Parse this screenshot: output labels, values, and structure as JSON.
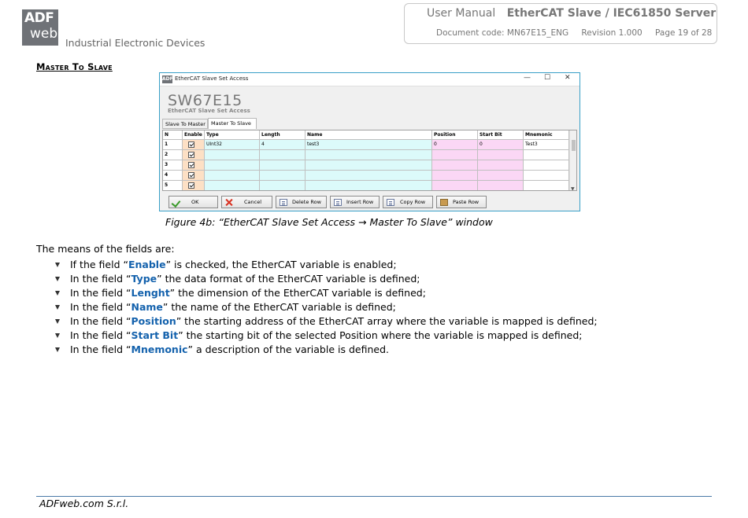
{
  "header": {
    "logo_top": "ADF",
    "logo_bottom": "web",
    "tagline": "Industrial Electronic Devices",
    "manual_label": "User Manual",
    "product": "EtherCAT Slave / IEC61850 Server",
    "document_code": "Document code: MN67E15_ENG",
    "revision": "Revision 1.000",
    "page": "Page 19 of 28"
  },
  "section_title": "Master To Slave",
  "window": {
    "title": "EtherCAT Slave Set Access",
    "app_icon_text": "ADF",
    "controls": {
      "minimize": "—",
      "maximize": "☐",
      "close": "✕"
    },
    "app_name": "SW67E15",
    "app_subtitle": "EtherCAT Slave Set Access",
    "tabs": [
      {
        "label": "Slave To Master",
        "active": false
      },
      {
        "label": "Master To Slave",
        "active": true
      }
    ],
    "table": {
      "columns": [
        "N",
        "Enable",
        "Type",
        "Length",
        "Name",
        "Position",
        "Start Bit",
        "Mnemonic"
      ],
      "rows": [
        {
          "n": "1",
          "enable": true,
          "type": "UInt32",
          "length": "4",
          "name": "test3",
          "position": "0",
          "start_bit": "0",
          "mnemonic": "Test3"
        },
        {
          "n": "2",
          "enable": true,
          "type": "",
          "length": "",
          "name": "",
          "position": "",
          "start_bit": "",
          "mnemonic": ""
        },
        {
          "n": "3",
          "enable": true,
          "type": "",
          "length": "",
          "name": "",
          "position": "",
          "start_bit": "",
          "mnemonic": ""
        },
        {
          "n": "4",
          "enable": true,
          "type": "",
          "length": "",
          "name": "",
          "position": "",
          "start_bit": "",
          "mnemonic": ""
        },
        {
          "n": "5",
          "enable": true,
          "type": "",
          "length": "",
          "name": "",
          "position": "",
          "start_bit": "",
          "mnemonic": ""
        }
      ]
    },
    "buttons": {
      "ok": "OK",
      "cancel": "Cancel",
      "delete_row": "Delete Row",
      "insert_row": "Insert Row",
      "copy_row": "Copy Row",
      "paste_row": "Paste Row"
    },
    "colors": {
      "enable_column": "#fde0c5",
      "data_columns": "#dcfafa",
      "position_columns": "#fbd7f5",
      "border": "#3aa0c8"
    }
  },
  "caption": "Figure 4b: “EtherCAT Slave Set Access → Master To Slave” window",
  "intro": "The means of the fields are:",
  "bullets": [
    {
      "pre": "If the field “",
      "kw": "Enable",
      "post": "” is checked, the EtherCAT variable is enabled;"
    },
    {
      "pre": "In the field “",
      "kw": "Type",
      "post": "” the data format of the EtherCAT variable is defined;"
    },
    {
      "pre": "In the field “",
      "kw": "Lenght",
      "post": "” the dimension of the EtherCAT variable is defined;"
    },
    {
      "pre": "In the field “",
      "kw": "Name",
      "post": "” the name of the EtherCAT variable is defined;"
    },
    {
      "pre": "In the field “",
      "kw": "Position",
      "post": "” the starting address of the EtherCAT array where the variable is mapped is defined;"
    },
    {
      "pre": "In the field “",
      "kw": "Start Bit",
      "post": "” the starting bit of the selected Position where the variable is mapped is defined;"
    },
    {
      "pre": "In the field “",
      "kw": "Mnemonic",
      "post": "” a description of the variable is defined."
    }
  ],
  "footer": "ADFweb.com S.r.l.",
  "accent_color": "#1462ad"
}
